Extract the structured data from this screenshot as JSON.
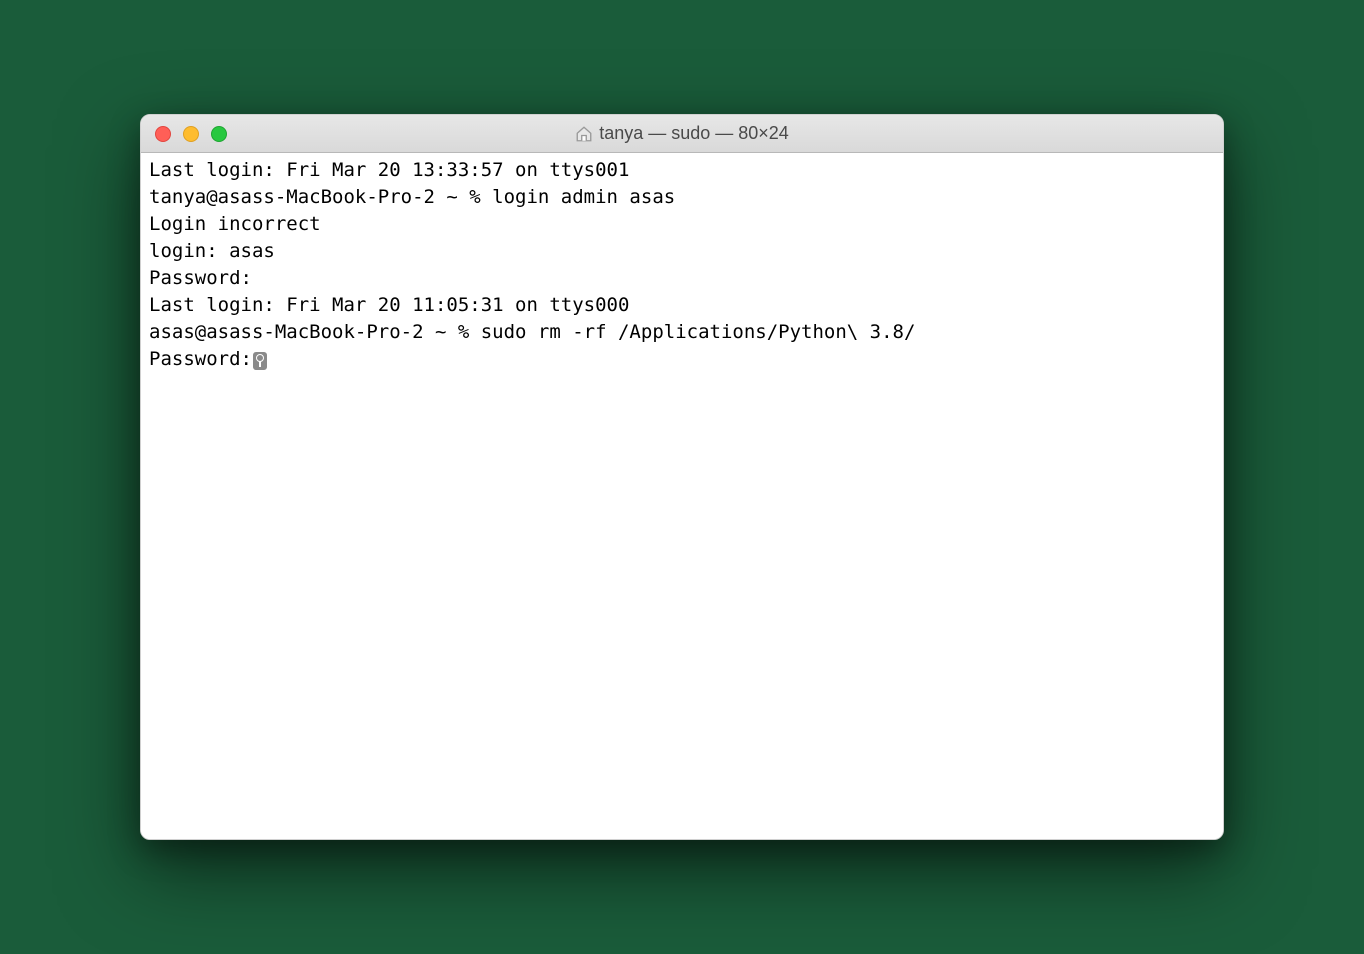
{
  "window": {
    "title": "tanya — sudo — 80×24"
  },
  "terminal": {
    "lines": [
      "Last login: Fri Mar 20 13:33:57 on ttys001",
      "tanya@asass-MacBook-Pro-2 ~ % login admin asas",
      "Login incorrect",
      "login: asas",
      "Password:",
      "Last login: Fri Mar 20 11:05:31 on ttys000",
      "asas@asass-MacBook-Pro-2 ~ % sudo rm -rf /Applications/Python\\ 3.8/",
      "Password:"
    ]
  }
}
